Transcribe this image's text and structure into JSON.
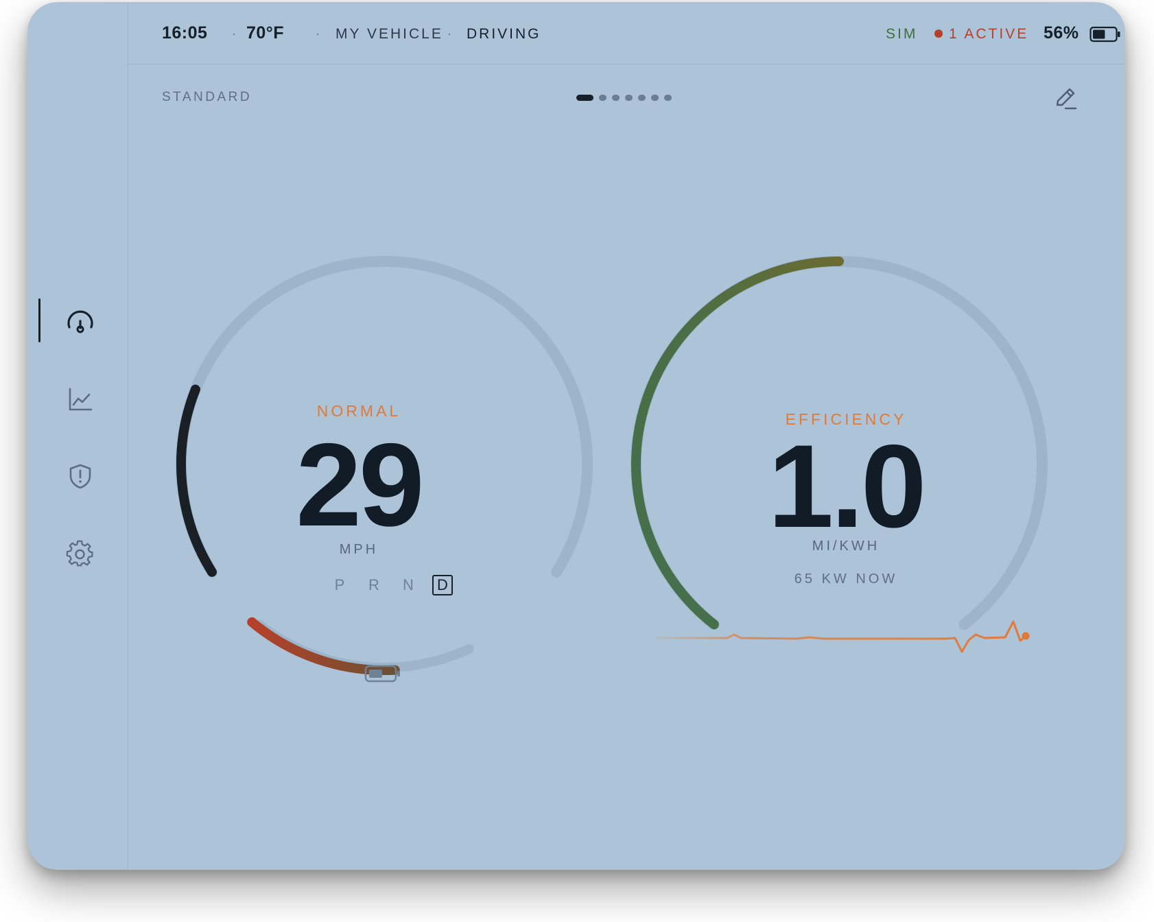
{
  "status_bar": {
    "time": "16:05",
    "temperature": "70°F",
    "vehicle": "MY VEHICLE",
    "state": "DRIVING",
    "sim": "SIM",
    "alerts": "1 ACTIVE",
    "battery_percent": "56%",
    "battery_level": 0.56
  },
  "sidebar": {
    "items": [
      {
        "name": "dashboard",
        "icon": "gauge-icon",
        "active": true
      },
      {
        "name": "charts",
        "icon": "chart-line-icon",
        "active": false
      },
      {
        "name": "alerts",
        "icon": "shield-alert-icon",
        "active": false
      },
      {
        "name": "settings",
        "icon": "gear-icon",
        "active": false
      }
    ]
  },
  "header": {
    "layout_label": "STANDARD",
    "pages_total": 7,
    "page_active": 1,
    "edit_icon": "pencil-icon"
  },
  "speed_gauge": {
    "mode": "NORMAL",
    "value": "29",
    "unit": "MPH",
    "gears": [
      "P",
      "R",
      "N",
      "D"
    ],
    "selected_gear": "D",
    "battery_icon": "battery-icon",
    "speed_fraction": 0.22,
    "battery_fraction": 0.56
  },
  "efficiency_gauge": {
    "title": "EFFICIENCY",
    "value": "1.0",
    "unit": "MI/KWH",
    "power": "65 KW NOW",
    "fill_fraction": 0.5
  },
  "colors": {
    "background": "#adc3d8",
    "accent_orange": "#e07a36",
    "sim_green": "#3f6e3c",
    "alert_red": "#b5412a",
    "gauge_track": "#9db4cb",
    "ink": "#121c27"
  }
}
